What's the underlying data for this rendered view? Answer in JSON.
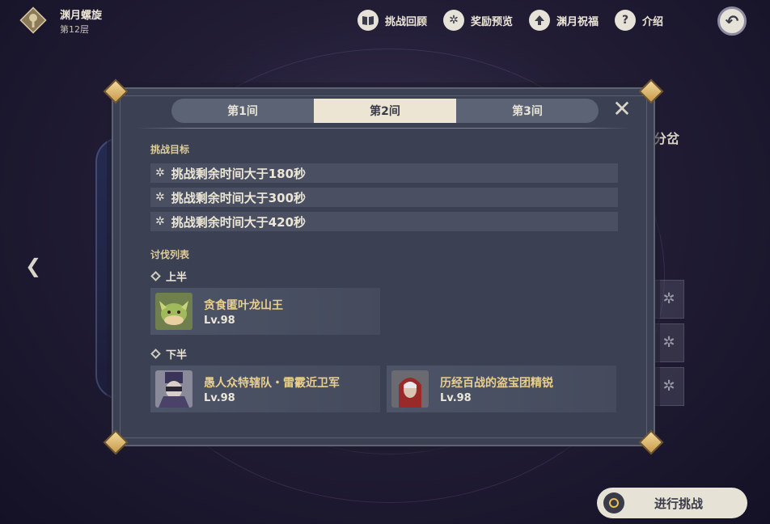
{
  "header": {
    "title": "渊月螺旋",
    "floor": "第12层"
  },
  "topnav": [
    {
      "label": "挑战回顾",
      "icon": "book-icon"
    },
    {
      "label": "奖励预览",
      "icon": "gear-star-icon"
    },
    {
      "label": "渊月祝福",
      "icon": "up-arrow-icon"
    },
    {
      "label": "介绍",
      "icon": "question-icon"
    }
  ],
  "background": {
    "right_text": "分岔"
  },
  "modal": {
    "tabs": [
      "第1间",
      "第2间",
      "第3间"
    ],
    "active_tab": 1,
    "goals_title": "挑战目标",
    "goals": [
      "挑战剩余时间大于180秒",
      "挑战剩余时间大于300秒",
      "挑战剩余时间大于420秒"
    ],
    "enemies_title": "讨伐列表",
    "first_half": {
      "label": "上半",
      "enemies": [
        {
          "name": "贪食匿叶龙山王",
          "level": "Lv.98"
        }
      ]
    },
    "second_half": {
      "label": "下半",
      "enemies": [
        {
          "name": "愚人众特辖队・雷霰近卫军",
          "level": "Lv.98"
        },
        {
          "name": "历经百战的盗宝团精锐",
          "level": "Lv.98"
        }
      ]
    }
  },
  "challenge_button": "进行挑战",
  "colors": {
    "accent_gold": "#e8cf8d",
    "panel": "#3b4153",
    "active_tab": "#ece5d4"
  }
}
